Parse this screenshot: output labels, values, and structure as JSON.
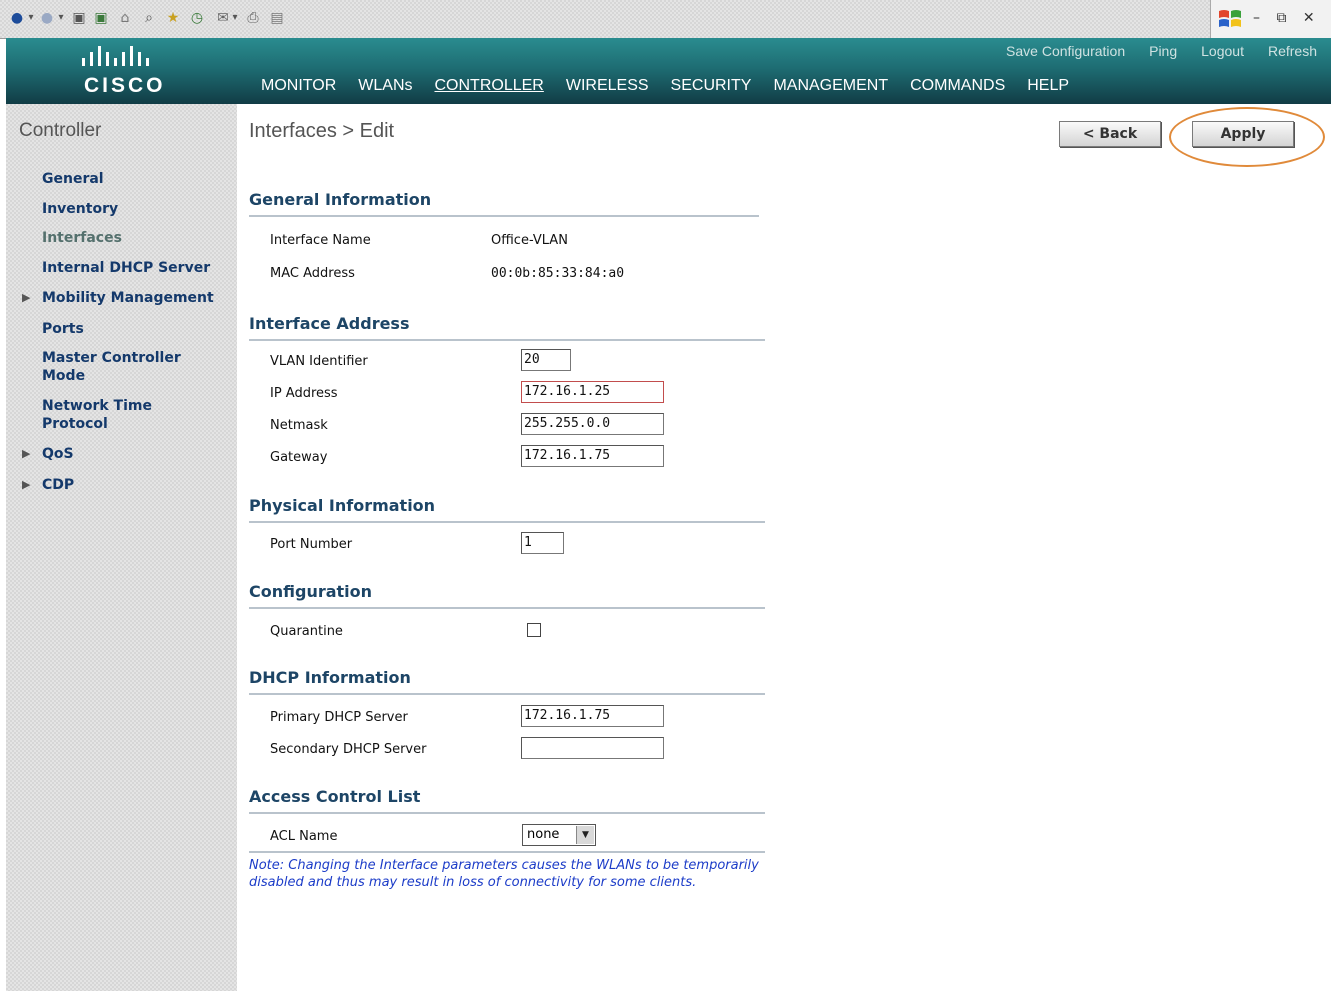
{
  "browser": {
    "window_controls": "– ⧉ ✕"
  },
  "header": {
    "logo_text": "CISCO",
    "top_links": [
      "Save Configuration",
      "Ping",
      "Logout",
      "Refresh"
    ],
    "nav": [
      "MONITOR",
      "WLANs",
      "CONTROLLER",
      "WIRELESS",
      "SECURITY",
      "MANAGEMENT",
      "COMMANDS",
      "HELP"
    ],
    "active_nav": "CONTROLLER"
  },
  "sidebar": {
    "title": "Controller",
    "items": [
      {
        "label": "General"
      },
      {
        "label": "Inventory"
      },
      {
        "label": "Interfaces",
        "current": true
      },
      {
        "label": "Internal DHCP Server"
      },
      {
        "label": "Mobility Management",
        "expandable": true
      },
      {
        "label": "Ports"
      },
      {
        "label": "Master Controller Mode"
      },
      {
        "label": "Network Time Protocol"
      },
      {
        "label": "QoS",
        "expandable": true
      },
      {
        "label": "CDP",
        "expandable": true
      }
    ]
  },
  "content": {
    "breadcrumb": "Interfaces > Edit",
    "back_button": "< Back",
    "apply_button": "Apply",
    "sections": {
      "general": {
        "title": "General Information",
        "interface_name_label": "Interface Name",
        "interface_name_value": "Office-VLAN",
        "mac_label": "MAC Address",
        "mac_value": "00:0b:85:33:84:a0"
      },
      "address": {
        "title": "Interface Address",
        "vlan_label": "VLAN Identifier",
        "vlan_value": "20",
        "ip_label": "IP Address",
        "ip_value": "172.16.1.25",
        "netmask_label": "Netmask",
        "netmask_value": "255.255.0.0",
        "gateway_label": "Gateway",
        "gateway_value": "172.16.1.75"
      },
      "physical": {
        "title": "Physical Information",
        "port_label": "Port Number",
        "port_value": "1"
      },
      "configuration": {
        "title": "Configuration",
        "quarantine_label": "Quarantine",
        "quarantine_checked": false
      },
      "dhcp": {
        "title": "DHCP Information",
        "primary_label": "Primary DHCP Server",
        "primary_value": "172.16.1.75",
        "secondary_label": "Secondary DHCP Server",
        "secondary_value": ""
      },
      "acl": {
        "title": "Access Control List",
        "acl_label": "ACL Name",
        "acl_value": "none"
      }
    },
    "note": "Note: Changing the Interface parameters causes the WLANs to be temporarily disabled and thus may result in loss of connectivity for some clients."
  },
  "colors": {
    "header_top": "#2a8c8f",
    "header_bottom": "#113c45",
    "sidebar_link": "#14396b",
    "section_title": "#1d4566",
    "note_text": "#1c3cc8",
    "apply_highlight": "#e08a3a"
  },
  "icons": [
    "back-icon",
    "forward-icon",
    "stop-icon",
    "refresh-icon",
    "home-icon",
    "search-icon",
    "favorites-icon",
    "history-icon",
    "mail-icon",
    "print-icon",
    "edit-icon"
  ]
}
